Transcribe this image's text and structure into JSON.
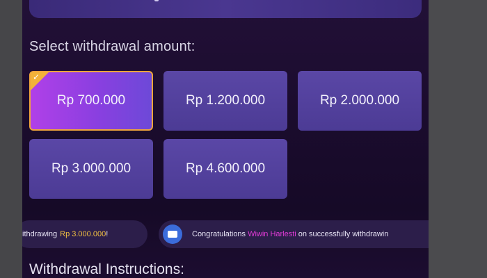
{
  "header": {
    "title": ""
  },
  "withdraw": {
    "label": "Select withdrawal amount:",
    "amounts": [
      "Rp 700.000",
      "Rp 1.200.000",
      "Rp 2.000.000",
      "Rp 3.000.000",
      "Rp 4.600.000"
    ],
    "selected_index": 0
  },
  "ticker": {
    "left": {
      "prefix": "ithdrawing",
      "amount": "Rp 3.000.000",
      "suffix": "!"
    },
    "right": {
      "prefix": "Congratulations",
      "name": "Wiwin Harlesti",
      "suffix": "on successfully withdrawin"
    },
    "icon": "megaphone-icon"
  },
  "instructions_title": "Withdrawal Instructions:",
  "colors": {
    "background": "#1b0c2e",
    "amount_card": "#5a47a6",
    "selected_gradient_start": "#b040e8",
    "selected_border": "#f0a53b",
    "highlight_gold": "#f4c241",
    "highlight_pink": "#e13bd6"
  }
}
